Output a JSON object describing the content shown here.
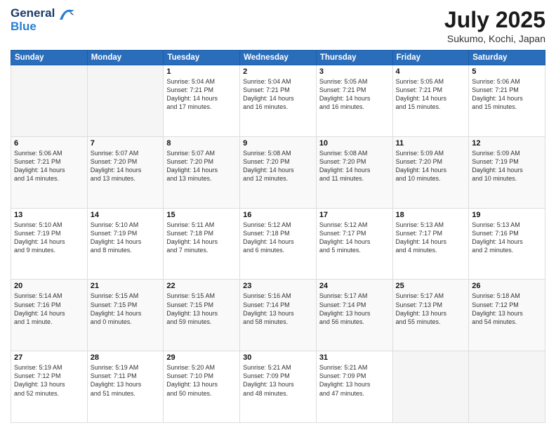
{
  "header": {
    "logo_line1": "General",
    "logo_line2": "Blue",
    "month": "July 2025",
    "location": "Sukumo, Kochi, Japan"
  },
  "days_of_week": [
    "Sunday",
    "Monday",
    "Tuesday",
    "Wednesday",
    "Thursday",
    "Friday",
    "Saturday"
  ],
  "weeks": [
    [
      {
        "day": "",
        "info": ""
      },
      {
        "day": "",
        "info": ""
      },
      {
        "day": "1",
        "info": "Sunrise: 5:04 AM\nSunset: 7:21 PM\nDaylight: 14 hours\nand 17 minutes."
      },
      {
        "day": "2",
        "info": "Sunrise: 5:04 AM\nSunset: 7:21 PM\nDaylight: 14 hours\nand 16 minutes."
      },
      {
        "day": "3",
        "info": "Sunrise: 5:05 AM\nSunset: 7:21 PM\nDaylight: 14 hours\nand 16 minutes."
      },
      {
        "day": "4",
        "info": "Sunrise: 5:05 AM\nSunset: 7:21 PM\nDaylight: 14 hours\nand 15 minutes."
      },
      {
        "day": "5",
        "info": "Sunrise: 5:06 AM\nSunset: 7:21 PM\nDaylight: 14 hours\nand 15 minutes."
      }
    ],
    [
      {
        "day": "6",
        "info": "Sunrise: 5:06 AM\nSunset: 7:21 PM\nDaylight: 14 hours\nand 14 minutes."
      },
      {
        "day": "7",
        "info": "Sunrise: 5:07 AM\nSunset: 7:20 PM\nDaylight: 14 hours\nand 13 minutes."
      },
      {
        "day": "8",
        "info": "Sunrise: 5:07 AM\nSunset: 7:20 PM\nDaylight: 14 hours\nand 13 minutes."
      },
      {
        "day": "9",
        "info": "Sunrise: 5:08 AM\nSunset: 7:20 PM\nDaylight: 14 hours\nand 12 minutes."
      },
      {
        "day": "10",
        "info": "Sunrise: 5:08 AM\nSunset: 7:20 PM\nDaylight: 14 hours\nand 11 minutes."
      },
      {
        "day": "11",
        "info": "Sunrise: 5:09 AM\nSunset: 7:20 PM\nDaylight: 14 hours\nand 10 minutes."
      },
      {
        "day": "12",
        "info": "Sunrise: 5:09 AM\nSunset: 7:19 PM\nDaylight: 14 hours\nand 10 minutes."
      }
    ],
    [
      {
        "day": "13",
        "info": "Sunrise: 5:10 AM\nSunset: 7:19 PM\nDaylight: 14 hours\nand 9 minutes."
      },
      {
        "day": "14",
        "info": "Sunrise: 5:10 AM\nSunset: 7:19 PM\nDaylight: 14 hours\nand 8 minutes."
      },
      {
        "day": "15",
        "info": "Sunrise: 5:11 AM\nSunset: 7:18 PM\nDaylight: 14 hours\nand 7 minutes."
      },
      {
        "day": "16",
        "info": "Sunrise: 5:12 AM\nSunset: 7:18 PM\nDaylight: 14 hours\nand 6 minutes."
      },
      {
        "day": "17",
        "info": "Sunrise: 5:12 AM\nSunset: 7:17 PM\nDaylight: 14 hours\nand 5 minutes."
      },
      {
        "day": "18",
        "info": "Sunrise: 5:13 AM\nSunset: 7:17 PM\nDaylight: 14 hours\nand 4 minutes."
      },
      {
        "day": "19",
        "info": "Sunrise: 5:13 AM\nSunset: 7:16 PM\nDaylight: 14 hours\nand 2 minutes."
      }
    ],
    [
      {
        "day": "20",
        "info": "Sunrise: 5:14 AM\nSunset: 7:16 PM\nDaylight: 14 hours\nand 1 minute."
      },
      {
        "day": "21",
        "info": "Sunrise: 5:15 AM\nSunset: 7:15 PM\nDaylight: 14 hours\nand 0 minutes."
      },
      {
        "day": "22",
        "info": "Sunrise: 5:15 AM\nSunset: 7:15 PM\nDaylight: 13 hours\nand 59 minutes."
      },
      {
        "day": "23",
        "info": "Sunrise: 5:16 AM\nSunset: 7:14 PM\nDaylight: 13 hours\nand 58 minutes."
      },
      {
        "day": "24",
        "info": "Sunrise: 5:17 AM\nSunset: 7:14 PM\nDaylight: 13 hours\nand 56 minutes."
      },
      {
        "day": "25",
        "info": "Sunrise: 5:17 AM\nSunset: 7:13 PM\nDaylight: 13 hours\nand 55 minutes."
      },
      {
        "day": "26",
        "info": "Sunrise: 5:18 AM\nSunset: 7:12 PM\nDaylight: 13 hours\nand 54 minutes."
      }
    ],
    [
      {
        "day": "27",
        "info": "Sunrise: 5:19 AM\nSunset: 7:12 PM\nDaylight: 13 hours\nand 52 minutes."
      },
      {
        "day": "28",
        "info": "Sunrise: 5:19 AM\nSunset: 7:11 PM\nDaylight: 13 hours\nand 51 minutes."
      },
      {
        "day": "29",
        "info": "Sunrise: 5:20 AM\nSunset: 7:10 PM\nDaylight: 13 hours\nand 50 minutes."
      },
      {
        "day": "30",
        "info": "Sunrise: 5:21 AM\nSunset: 7:09 PM\nDaylight: 13 hours\nand 48 minutes."
      },
      {
        "day": "31",
        "info": "Sunrise: 5:21 AM\nSunset: 7:09 PM\nDaylight: 13 hours\nand 47 minutes."
      },
      {
        "day": "",
        "info": ""
      },
      {
        "day": "",
        "info": ""
      }
    ]
  ]
}
